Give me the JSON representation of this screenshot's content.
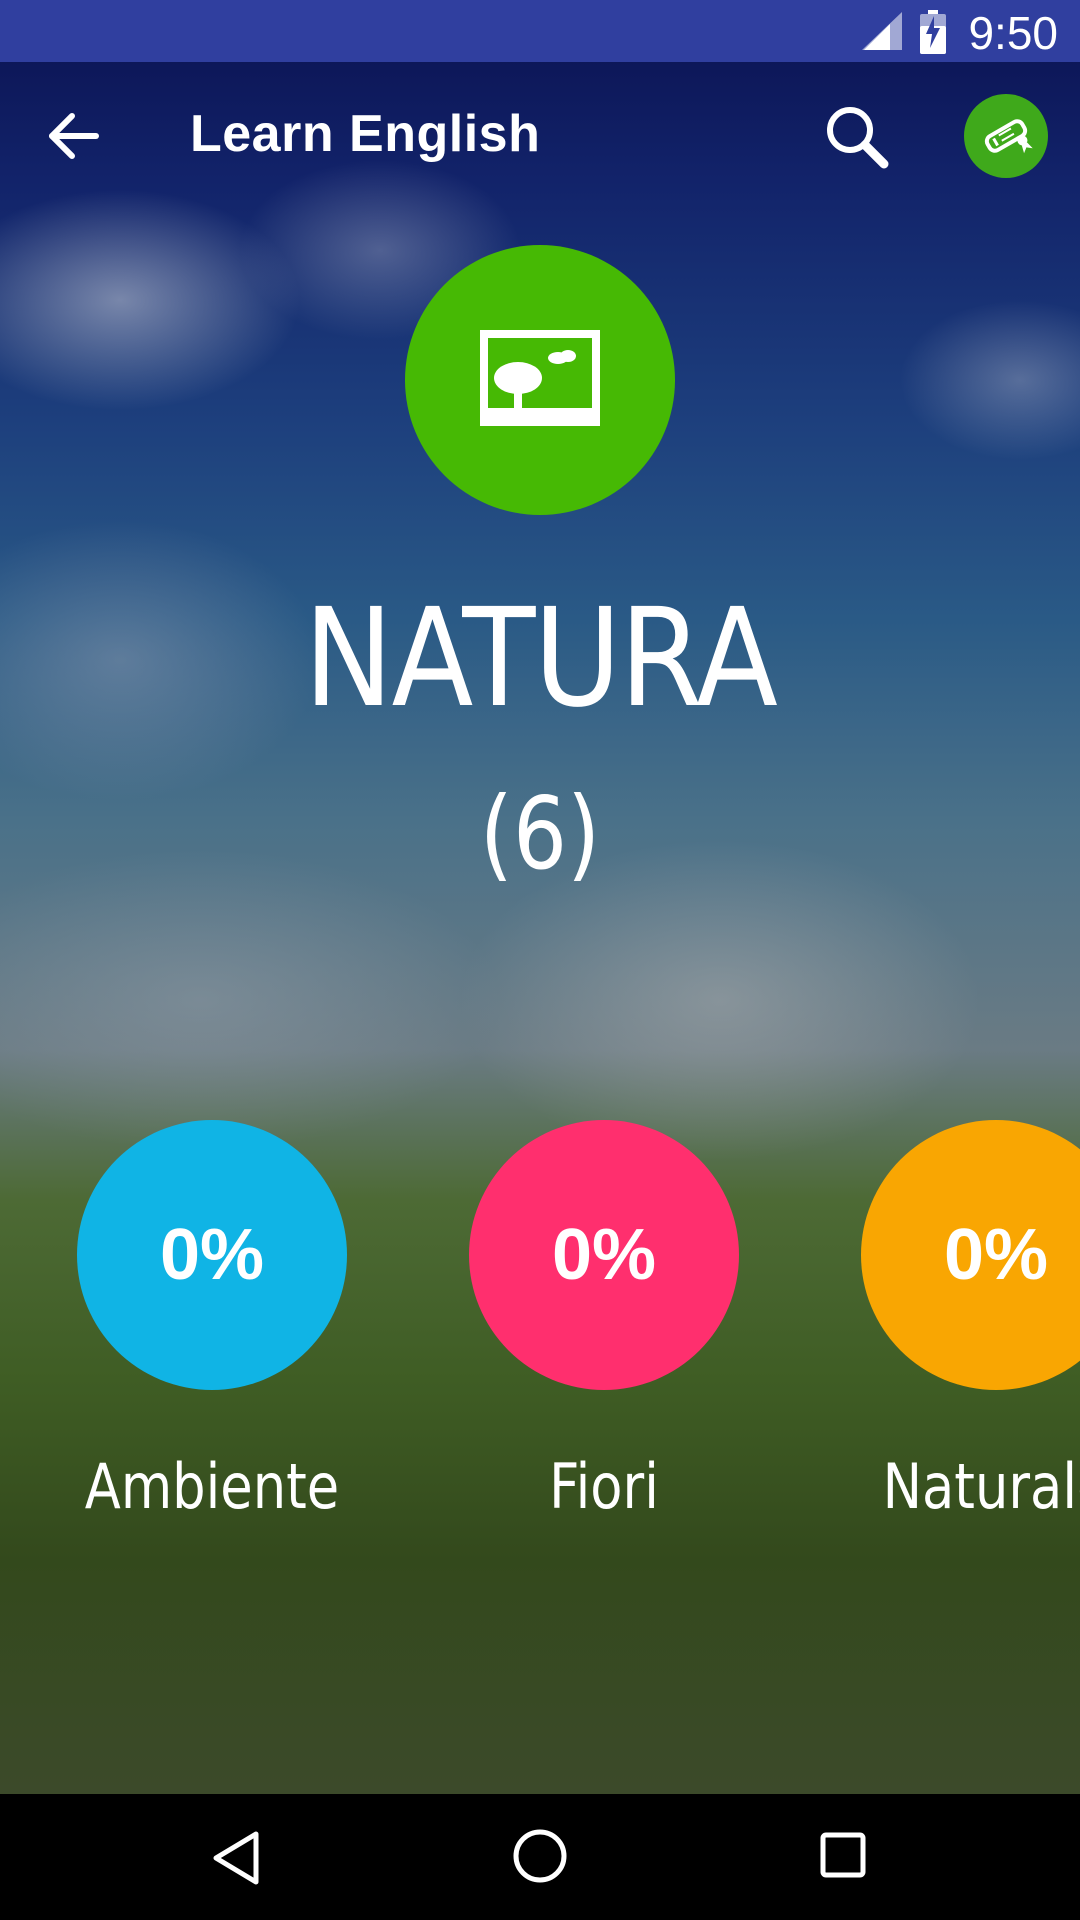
{
  "status_bar": {
    "time": "9:50"
  },
  "app_bar": {
    "title": "Learn English"
  },
  "category": {
    "title": "NATURA",
    "count": "(6)",
    "color": "#46b904"
  },
  "subcategories": [
    {
      "percent": "0%",
      "label": "Ambiente",
      "color": "#10b4e5"
    },
    {
      "percent": "0%",
      "label": "Fiori",
      "color": "#ff2f6e"
    },
    {
      "percent": "0%",
      "label": "Naturale",
      "color": "#f9a602"
    }
  ],
  "icons": {
    "back": "arrow-left-icon",
    "search": "search-icon",
    "certificate": "certificate-icon",
    "category": "landscape-picture-icon"
  }
}
